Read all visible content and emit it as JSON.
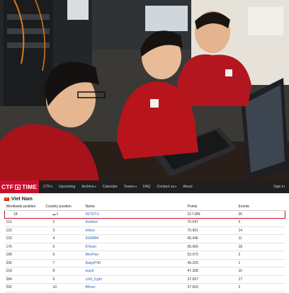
{
  "nav": {
    "logo_ctf": "CTF",
    "logo_time": "TIME",
    "items": [
      {
        "label": "CTFs",
        "caret": false
      },
      {
        "label": "Upcoming",
        "caret": false
      },
      {
        "label": "Archive",
        "caret": true
      },
      {
        "label": "Calendar",
        "caret": false
      },
      {
        "label": "Teams",
        "caret": true
      },
      {
        "label": "FAQ",
        "caret": false
      },
      {
        "label": "Contact us",
        "caret": true
      },
      {
        "label": "About",
        "caret": false
      }
    ],
    "signin": "Sign in"
  },
  "ranking": {
    "country": "Viet Nam",
    "headers": [
      "Worldwide position",
      "Country position",
      "Name",
      "Points",
      "Events"
    ],
    "rows": [
      {
        "ww": "18",
        "cp": "1",
        "name": "ISITDTU",
        "points": "217.089",
        "events": "26",
        "highlight": true
      },
      {
        "ww": "113",
        "cp": "2",
        "name": "Aceltive",
        "points": "75.047",
        "events": "3"
      },
      {
        "ww": "122",
        "cp": "3",
        "name": "efiens",
        "points": "70.901",
        "events": "14"
      },
      {
        "ww": "133",
        "cp": "4",
        "name": "Kh0RBK",
        "points": "66.446",
        "events": "11"
      },
      {
        "ww": "176",
        "cp": "5",
        "name": "BTeam",
        "points": "55.060",
        "events": "18"
      },
      {
        "ww": "168",
        "cp": "6",
        "name": "MeoPan",
        "points": "52.070",
        "events": "2"
      },
      {
        "ww": "206",
        "cp": "7",
        "name": "BabyPHD",
        "points": "49.220",
        "events": "1"
      },
      {
        "ww": "218",
        "cp": "8",
        "name": "wand",
        "points": "47.268",
        "events": "16"
      },
      {
        "ww": "284",
        "cp": "9",
        "name": "z3r0_l1ght",
        "points": "37.667",
        "events": "17"
      },
      {
        "ww": "292",
        "cp": "10",
        "name": "BKsec",
        "points": "37.603",
        "events": "2"
      }
    ]
  }
}
